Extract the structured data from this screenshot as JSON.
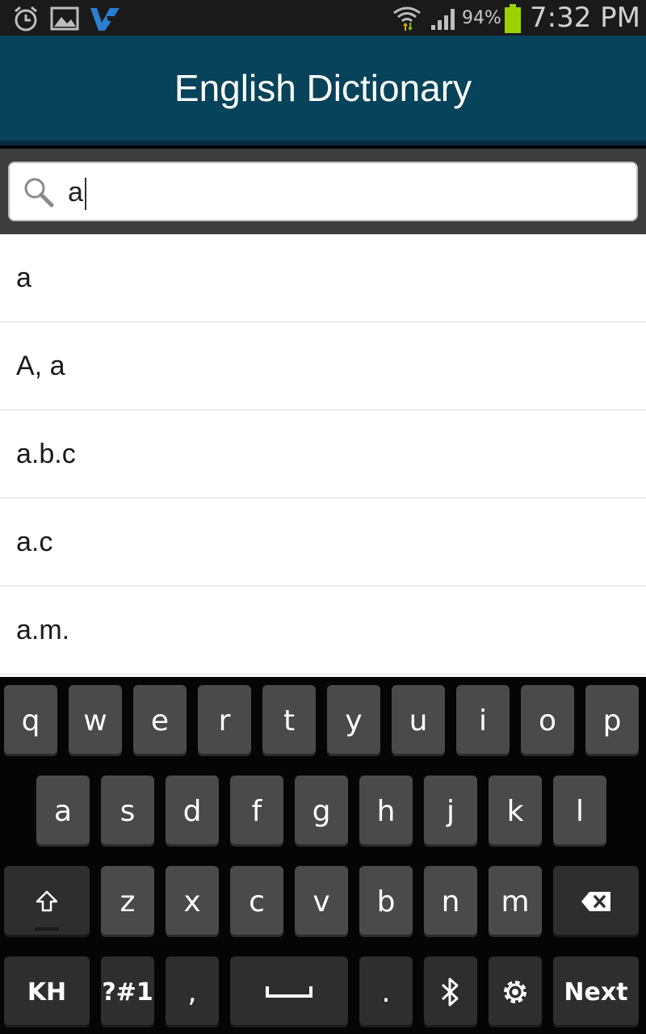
{
  "status_bar": {
    "battery_percent": "94%",
    "time": "7:32 PM",
    "icons": [
      "alarm-icon",
      "image-icon",
      "app-icon",
      "wifi-icon",
      "signal-icon",
      "battery-icon"
    ]
  },
  "header": {
    "title": "English Dictionary"
  },
  "search": {
    "value": "a",
    "icon": "search-icon"
  },
  "results": [
    {
      "label": "a"
    },
    {
      "label": "A, a"
    },
    {
      "label": "a.b.c"
    },
    {
      "label": "a.c"
    },
    {
      "label": "a.m."
    }
  ],
  "keyboard": {
    "row1": [
      "q",
      "w",
      "e",
      "r",
      "t",
      "y",
      "u",
      "i",
      "o",
      "p"
    ],
    "row2": [
      "a",
      "s",
      "d",
      "f",
      "g",
      "h",
      "j",
      "k",
      "l"
    ],
    "row3": [
      "z",
      "x",
      "c",
      "v",
      "b",
      "n",
      "m"
    ],
    "lang_label": "KH",
    "symbols_label": "?#1",
    "comma_label": ",",
    "period_label": ".",
    "next_label": "Next"
  },
  "colors": {
    "title_bar": "#07435a",
    "status_bar": "#1a1a1a",
    "key": "#4a4a4a"
  }
}
